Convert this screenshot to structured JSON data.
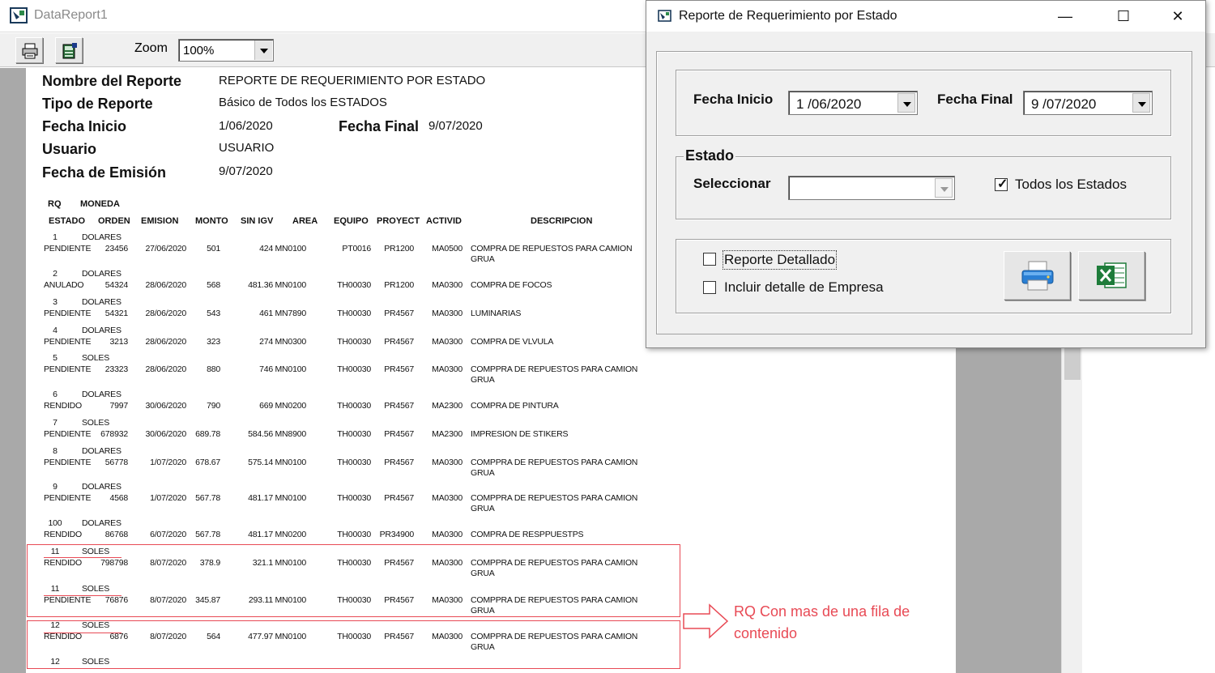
{
  "data_report": {
    "window_title": "DataReport1",
    "zoom_label": "Zoom",
    "zoom_value": "100%",
    "header": {
      "nombre_label": "Nombre del Reporte",
      "nombre_value": "REPORTE DE REQUERIMIENTO POR ESTADO",
      "tipo_label": "Tipo de Reporte",
      "tipo_value": "Básico de Todos los ESTADOS",
      "inicio_label": "Fecha Inicio",
      "inicio_value": "1/06/2020",
      "final_label": "Fecha Final",
      "final_value": "9/07/2020",
      "usuario_label": "Usuario",
      "usuario_value": "USUARIO",
      "emision_label": "Fecha de Emisión",
      "emision_value": "9/07/2020"
    },
    "columns_top": [
      "RQ",
      "MONEDA"
    ],
    "columns": [
      "ESTADO",
      "ORDEN",
      "EMISION",
      "MONTO",
      "SIN IGV",
      "AREA",
      "EQUIPO",
      "PROYECT",
      "ACTIVID",
      "DESCRIPCION"
    ],
    "records": [
      {
        "rq": "1",
        "moneda": "DOLARES",
        "estado": "PENDIENTE",
        "orden": "23456",
        "emision": "27/06/2020",
        "monto": "501",
        "sin_igv": "424",
        "area": "MN0100",
        "equipo": "PT0016",
        "proyect": "PR1200",
        "activid": "MA0500",
        "descripcion": "COMPRA DE REPUESTOS PARA CAMION",
        "descripcion2": "GRUA"
      },
      {
        "rq": "2",
        "moneda": "DOLARES",
        "estado": "ANULADO",
        "orden": "54324",
        "emision": "28/06/2020",
        "monto": "568",
        "sin_igv": "481.36",
        "area": "MN0100",
        "equipo": "TH00030",
        "proyect": "PR1200",
        "activid": "MA0300",
        "descripcion": "COMPRA DE FOCOS",
        "descripcion2": ""
      },
      {
        "rq": "3",
        "moneda": "DOLARES",
        "estado": "PENDIENTE",
        "orden": "54321",
        "emision": "28/06/2020",
        "monto": "543",
        "sin_igv": "461",
        "area": "MN7890",
        "equipo": "TH00030",
        "proyect": "PR4567",
        "activid": "MA0300",
        "descripcion": "LUMINARIAS",
        "descripcion2": ""
      },
      {
        "rq": "4",
        "moneda": "DOLARES",
        "estado": "PENDIENTE",
        "orden": "3213",
        "emision": "28/06/2020",
        "monto": "323",
        "sin_igv": "274",
        "area": "MN0300",
        "equipo": "TH00030",
        "proyect": "PR4567",
        "activid": "MA0300",
        "descripcion": "COMPRA DE VLVULA",
        "descripcion2": ""
      },
      {
        "rq": "5",
        "moneda": "SOLES",
        "estado": "PENDIENTE",
        "orden": "23323",
        "emision": "28/06/2020",
        "monto": "880",
        "sin_igv": "746",
        "area": "MN0100",
        "equipo": "TH00030",
        "proyect": "PR4567",
        "activid": "MA0300",
        "descripcion": "COMPPRA DE REPUESTOS PARA CAMION",
        "descripcion2": "GRUA"
      },
      {
        "rq": "6",
        "moneda": "DOLARES",
        "estado": "RENDIDO",
        "orden": "7997",
        "emision": "30/06/2020",
        "monto": "790",
        "sin_igv": "669",
        "area": "MN0200",
        "equipo": "TH00030",
        "proyect": "PR4567",
        "activid": "MA2300",
        "descripcion": "COMPRA DE PINTURA",
        "descripcion2": ""
      },
      {
        "rq": "7",
        "moneda": "SOLES",
        "estado": "PENDIENTE",
        "orden": "678932",
        "emision": "30/06/2020",
        "monto": "689.78",
        "sin_igv": "584.56",
        "area": "MN8900",
        "equipo": "TH00030",
        "proyect": "PR4567",
        "activid": "MA2300",
        "descripcion": "IMPRESION DE STIKERS",
        "descripcion2": ""
      },
      {
        "rq": "8",
        "moneda": "DOLARES",
        "estado": "PENDIENTE",
        "orden": "56778",
        "emision": "1/07/2020",
        "monto": "678.67",
        "sin_igv": "575.14",
        "area": "MN0100",
        "equipo": "TH00030",
        "proyect": "PR4567",
        "activid": "MA0300",
        "descripcion": "COMPPRA DE REPUESTOS PARA CAMION",
        "descripcion2": "GRUA"
      },
      {
        "rq": "9",
        "moneda": "DOLARES",
        "estado": "PENDIENTE",
        "orden": "4568",
        "emision": "1/07/2020",
        "monto": "567.78",
        "sin_igv": "481.17",
        "area": "MN0100",
        "equipo": "TH00030",
        "proyect": "PR4567",
        "activid": "MA0300",
        "descripcion": "COMPPRA DE REPUESTOS PARA CAMION",
        "descripcion2": "GRUA"
      },
      {
        "rq": "100",
        "moneda": "DOLARES",
        "estado": "RENDIDO",
        "orden": "86768",
        "emision": "6/07/2020",
        "monto": "567.78",
        "sin_igv": "481.17",
        "area": "MN0200",
        "equipo": "TH00030",
        "proyect": "PR34900",
        "activid": "MA0300",
        "descripcion": "COMPRA DE RESPPUESTPS",
        "descripcion2": ""
      },
      {
        "rq": "11",
        "moneda": "SOLES",
        "estado": "RENDIDO",
        "orden": "798798",
        "emision": "8/07/2020",
        "monto": "378.9",
        "sin_igv": "321.1",
        "area": "MN0100",
        "equipo": "TH00030",
        "proyect": "PR4567",
        "activid": "MA0300",
        "descripcion": "COMPPRA DE REPUESTOS PARA CAMION",
        "descripcion2": "GRUA"
      },
      {
        "rq": "11",
        "moneda": "SOLES",
        "estado": "PENDIENTE",
        "orden": "76876",
        "emision": "8/07/2020",
        "monto": "345.87",
        "sin_igv": "293.11",
        "area": "MN0100",
        "equipo": "TH00030",
        "proyect": "PR4567",
        "activid": "MA0300",
        "descripcion": "COMPPRA DE REPUESTOS PARA CAMION",
        "descripcion2": "GRUA"
      },
      {
        "rq": "12",
        "moneda": "SOLES",
        "estado": "RENDIDO",
        "orden": "6876",
        "emision": "8/07/2020",
        "monto": "564",
        "sin_igv": "477.97",
        "area": "MN0100",
        "equipo": "TH00030",
        "proyect": "PR4567",
        "activid": "MA0300",
        "descripcion": "COMPPRA DE REPUESTOS PARA CAMION",
        "descripcion2": "GRUA"
      },
      {
        "rq": "12",
        "moneda": "SOLES",
        "estado": "",
        "orden": "",
        "emision": "",
        "monto": "",
        "sin_igv": "",
        "area": "",
        "equipo": "",
        "proyect": "",
        "activid": "",
        "descripcion": "",
        "descripcion2": ""
      }
    ],
    "annotation": "RQ Con mas de una fila de contenido"
  },
  "dialog": {
    "title": "Reporte de Requerimiento por Estado",
    "minimize": "—",
    "maximize": "☐",
    "close": "✕",
    "fecha_inicio_label": "Fecha Inicio",
    "fecha_inicio_value": "1 /06/2020",
    "fecha_final_label": "Fecha Final",
    "fecha_final_value": "9 /07/2020",
    "estado_legend": "Estado",
    "seleccionar_label": "Seleccionar",
    "seleccionar_value": "",
    "todos_label": "Todos los Estados",
    "todos_checked": true,
    "detallado_label": "Reporte Detallado",
    "detallado_checked": false,
    "empresa_label": "Incluir detalle de Empresa",
    "empresa_checked": false
  },
  "colors": {
    "accent_red": "#e84a55",
    "excel_green": "#1e7c3a",
    "printer_blue": "#2a7fd4"
  }
}
